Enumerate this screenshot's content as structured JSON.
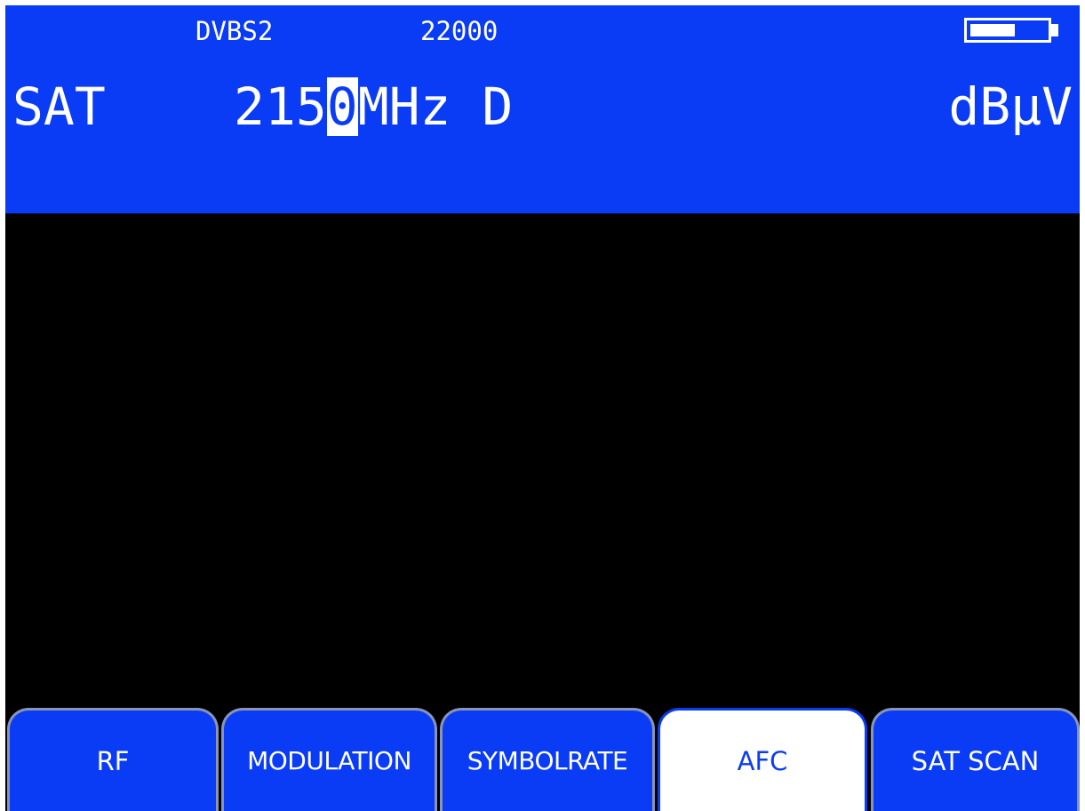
{
  "header": {
    "modulation": "DVBS2",
    "symbol_rate": "22000",
    "band": "SAT",
    "frequency_prefix": "215",
    "frequency_cursor_digit": "0",
    "frequency_suffix": "MHz D",
    "unit": "dBµV",
    "battery_level": 0.6
  },
  "softkeys": [
    {
      "label": "RF",
      "active": false
    },
    {
      "label": "MODULATION",
      "active": false
    },
    {
      "label": "SYMBOLRATE",
      "active": false
    },
    {
      "label": "AFC",
      "active": true
    },
    {
      "label": "SAT SCAN",
      "active": false
    }
  ],
  "colors": {
    "accent_blue": "#0a3cf5",
    "screen_background": "#000000",
    "text": "#ffffff"
  }
}
